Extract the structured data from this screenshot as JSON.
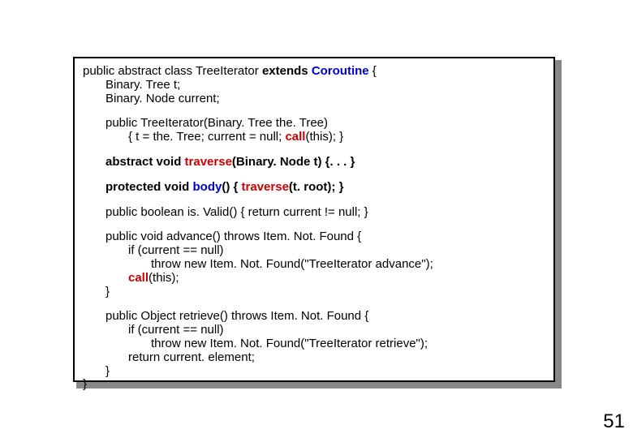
{
  "page_number": "51",
  "code": {
    "l1a": "public abstract class TreeIterator ",
    "l1b": "extends",
    "l1c": " ",
    "l1d": "Coroutine",
    "l1e": " {",
    "l2": "Binary. Tree t;",
    "l3": "Binary. Node current;",
    "l4": "public TreeIterator(Binary. Tree the. Tree)",
    "l5a": "{ t = the. Tree; current = null; ",
    "l5b": "call",
    "l5c": "(this); }",
    "l6a": "abstract void ",
    "l6b": "traverse",
    "l6c": "(Binary. Node t) {. . . }",
    "l7a": "protected void ",
    "l7b": "body",
    "l7c": "() { ",
    "l7d": "traverse",
    "l7e": "(t. root); }",
    "l8": "public boolean is. Valid() { return current != null; }",
    "l9": "public void advance() throws Item. Not. Found {",
    "l10": "if (current == null)",
    "l11": "throw new Item. Not. Found(\"TreeIterator advance\");",
    "l12a": "call",
    "l12b": "(this);",
    "l13": "}",
    "l14": "public Object retrieve() throws Item. Not. Found {",
    "l15": "if (current == null)",
    "l16": "throw new Item. Not. Found(\"TreeIterator retrieve\");",
    "l17": "return current. element;",
    "l18": "}",
    "l19": "}"
  }
}
